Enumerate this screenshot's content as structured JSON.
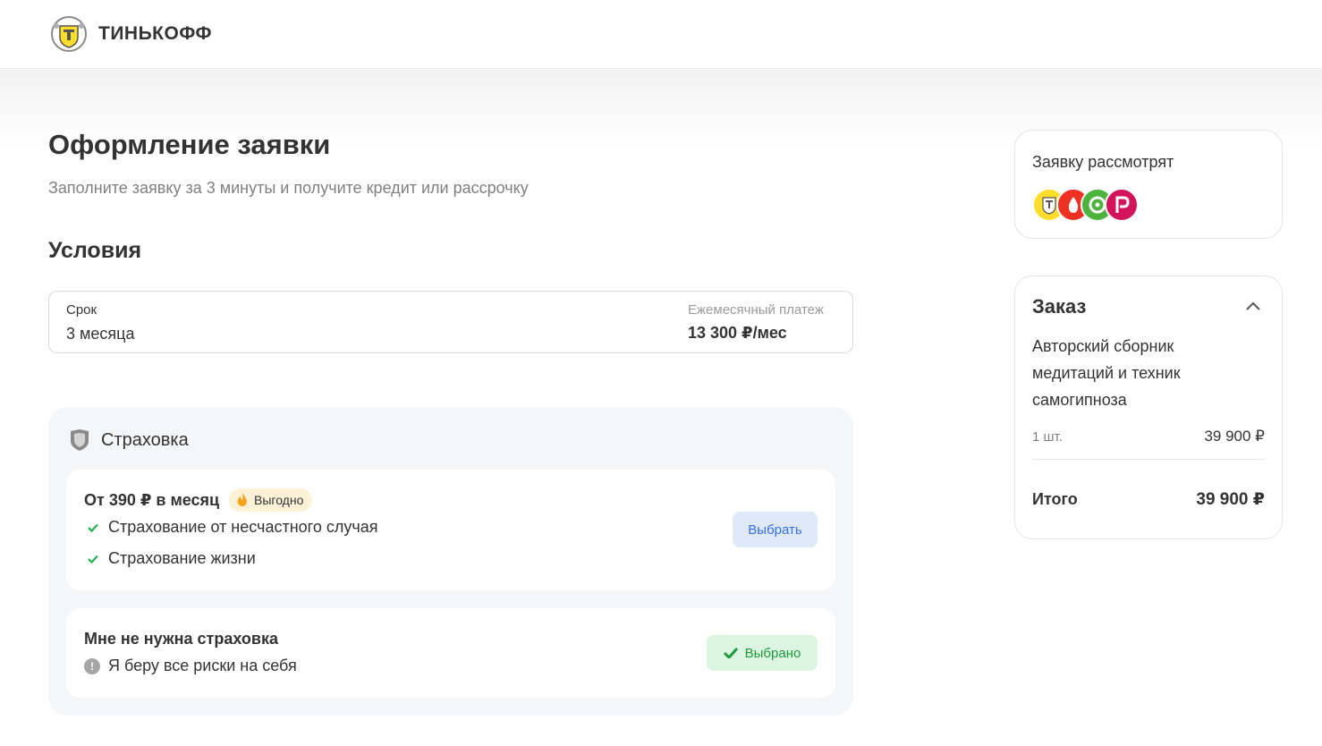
{
  "header": {
    "brand": "ТИНЬКОФФ"
  },
  "main": {
    "title": "Оформление заявки",
    "subtitle": "Заполните заявку за 3 минуты и получите кредит или рассрочку",
    "conditions_title": "Условия",
    "term": {
      "label": "Срок",
      "value": "3 месяца"
    },
    "monthly": {
      "label": "Ежемесячный платеж",
      "value": "13 300 ₽/мес"
    }
  },
  "insurance": {
    "title": "Страховка",
    "option_paid": {
      "title": "От 390 ₽ в месяц",
      "badge": "Выгодно",
      "features": [
        "Страхование от несчастного случая",
        "Страхование жизни"
      ],
      "button": "Выбрать"
    },
    "option_none": {
      "title": "Мне не нужна страховка",
      "note": "Я беру все риски на себя",
      "button": "Выбрано"
    }
  },
  "sidebar": {
    "review": {
      "title": "Заявку рассмотрят",
      "banks": [
        "tinkoff-logo",
        "alfa-logo",
        "otp-logo",
        "rosbank-logo"
      ]
    },
    "order": {
      "title": "Заказ",
      "product": "Авторский сборник медитаций и техник самогипноза",
      "qty": "1 шт.",
      "price": "39 900 ₽",
      "total_label": "Итого",
      "total_value": "39 900 ₽"
    }
  },
  "colors": {
    "accent_blue": "#336fee",
    "selected_green": "#1d9a3c",
    "badge_bg": "#fdf1d6",
    "brand_yellow": "#ffdd2d"
  }
}
